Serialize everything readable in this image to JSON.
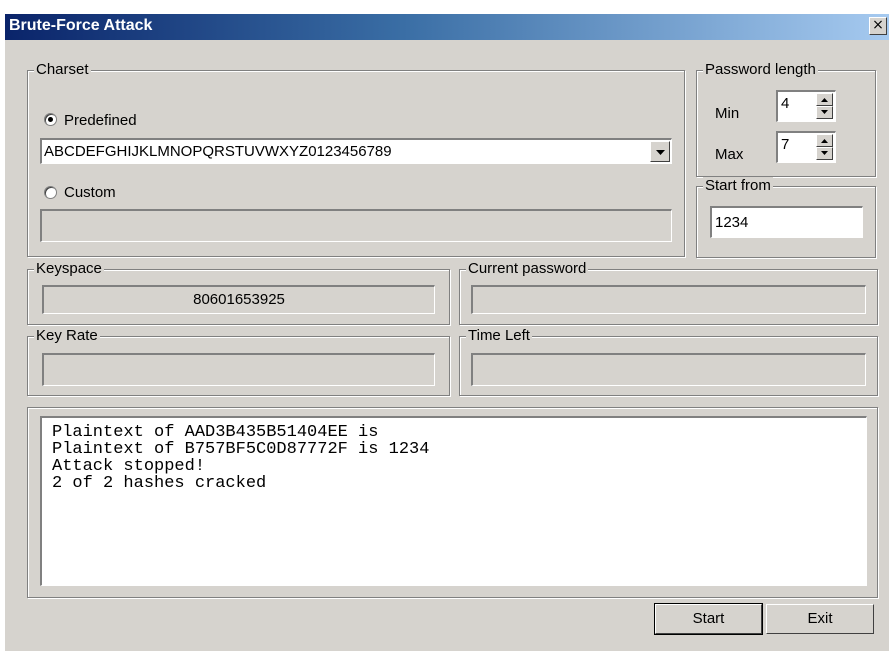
{
  "window": {
    "title": "Brute-Force Attack",
    "close_glyph": "×"
  },
  "charset": {
    "legend": "Charset",
    "predefined_label": "Predefined",
    "predefined_selected": true,
    "predefined_value": "ABCDEFGHIJKLMNOPQRSTUVWXYZ0123456789",
    "custom_label": "Custom",
    "custom_selected": false,
    "custom_value": ""
  },
  "password_length": {
    "legend": "Password length",
    "min_label": "Min",
    "min_value": "4",
    "max_label": "Max",
    "max_value": "7"
  },
  "start_from": {
    "legend": "Start from",
    "value": "1234"
  },
  "keyspace": {
    "legend": "Keyspace",
    "value": "80601653925"
  },
  "current_password": {
    "legend": "Current password",
    "value": ""
  },
  "key_rate": {
    "legend": "Key Rate",
    "value": ""
  },
  "time_left": {
    "legend": "Time Left",
    "value": ""
  },
  "log": {
    "lines": [
      "Plaintext of AAD3B435B51404EE is",
      "Plaintext of B757BF5C0D87772F is 1234",
      "Attack stopped!",
      "2 of 2 hashes cracked"
    ]
  },
  "buttons": {
    "start_label": "Start",
    "exit_label": "Exit"
  },
  "colors": {
    "title_bar_start": "#0a246a",
    "title_bar_end": "#a6caf0",
    "dialog_bg": "#d6d3ce"
  }
}
